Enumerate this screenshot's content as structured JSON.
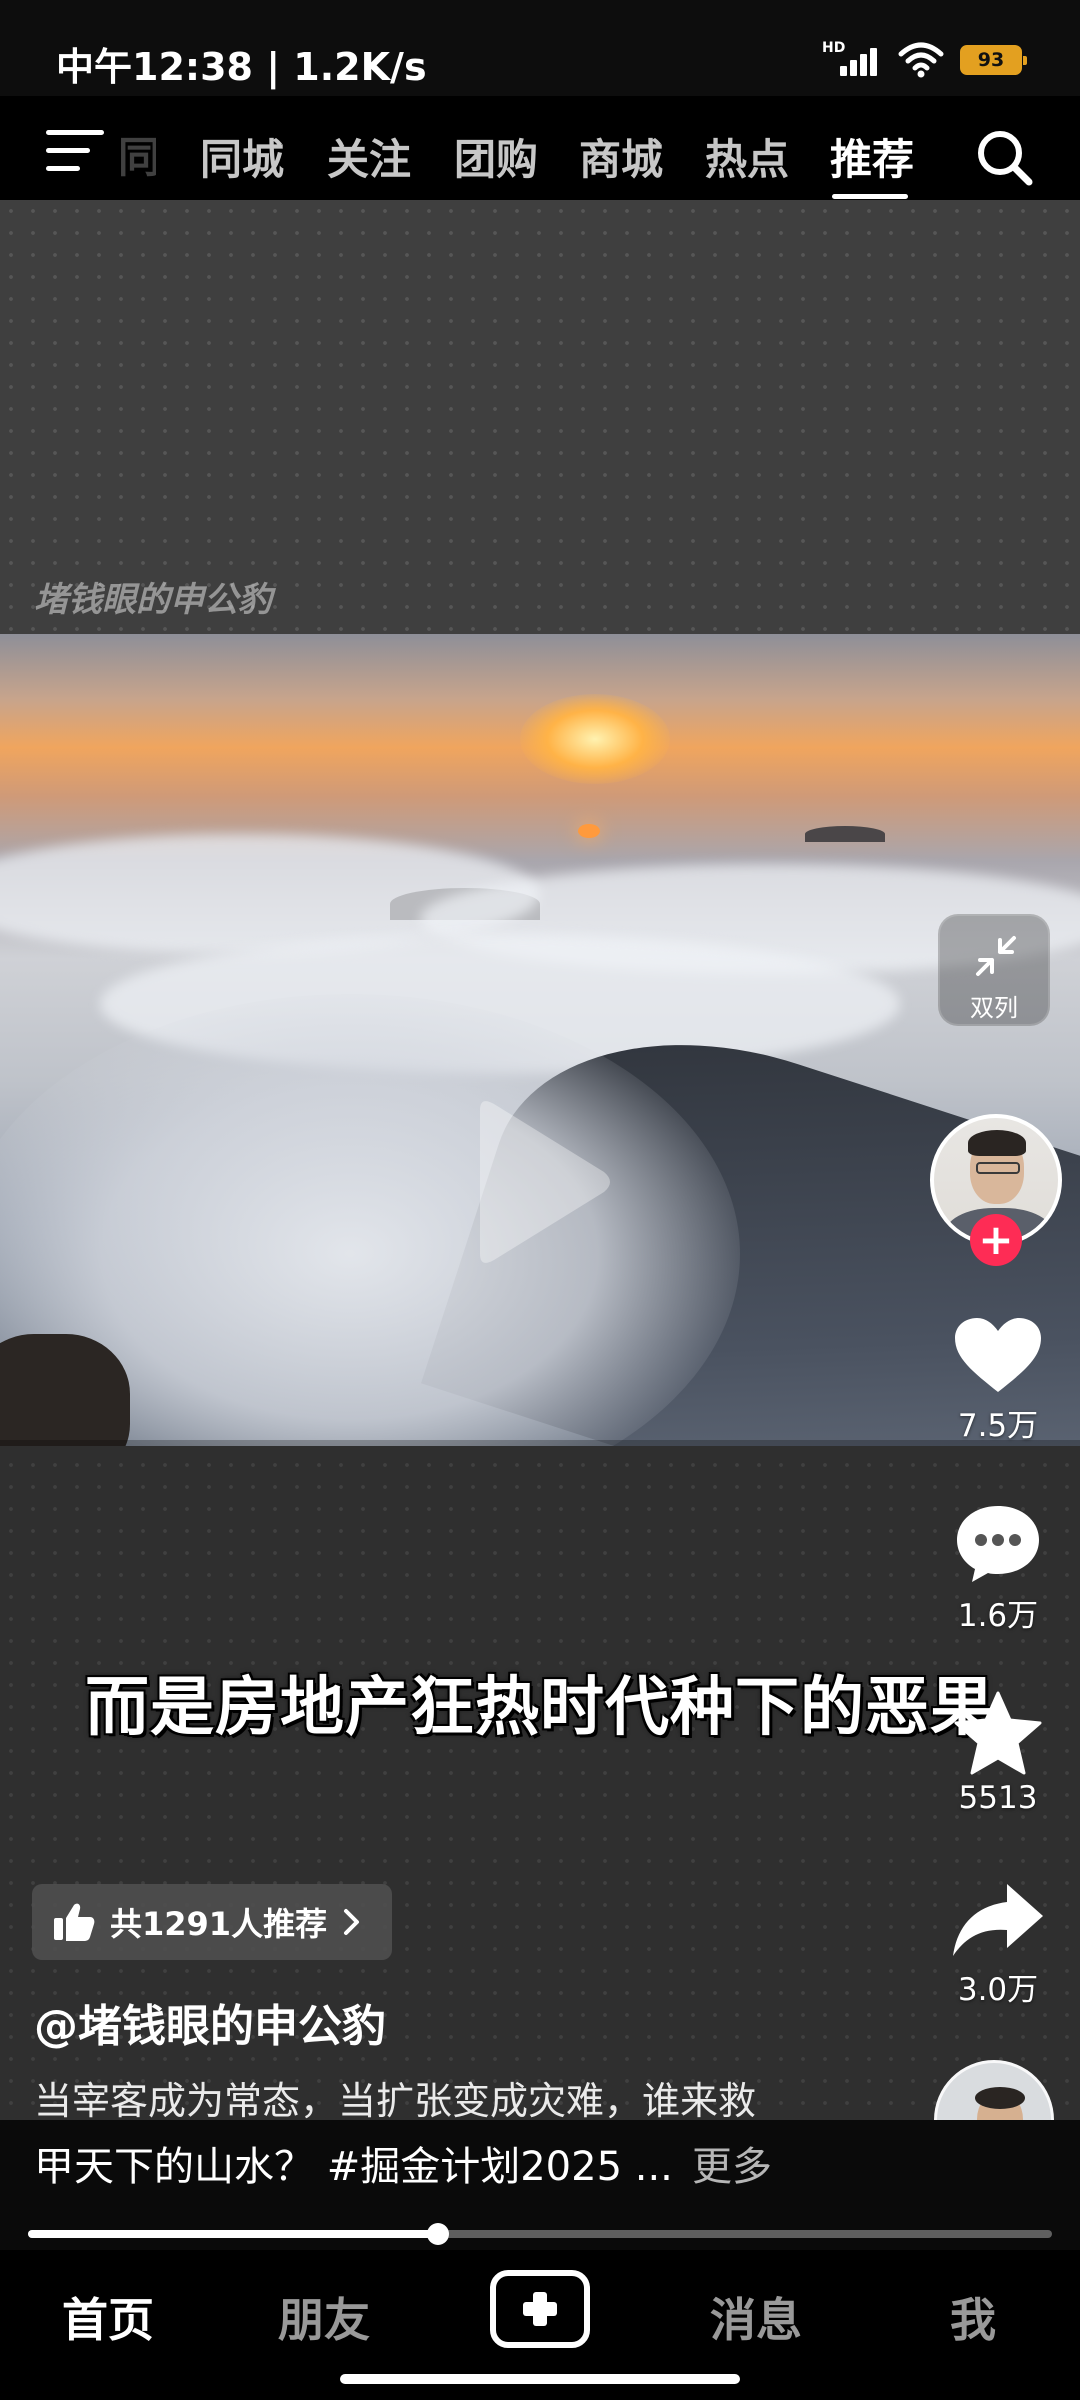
{
  "status_bar": {
    "time": "中午12:38 | 1.2K/s",
    "signal_label": "HD",
    "battery": "93",
    "battery_color": "#e3a020"
  },
  "top_nav": {
    "partial_tab": "同",
    "tabs": [
      {
        "label": "同城",
        "active": false
      },
      {
        "label": "关注",
        "active": false
      },
      {
        "label": "团购",
        "active": false
      },
      {
        "label": "商城",
        "active": false
      },
      {
        "label": "热点",
        "active": false
      },
      {
        "label": "推荐",
        "active": true
      }
    ],
    "icons": {
      "menu": "menu-icon",
      "search": "search-icon"
    }
  },
  "video": {
    "watermark": "堵钱眼的申公豹",
    "caption": "而是房地产狂热时代种下的恶果",
    "progress": 0.4
  },
  "right_rail": {
    "dual_col_label": "双列",
    "follow_symbol": "+",
    "like_count": "7.5万",
    "comment_count": "1.6万",
    "favorite_count": "5513",
    "share_count": "3.0万",
    "accent_color": "#fe2c55"
  },
  "info": {
    "recommend": "共1291人推荐",
    "username": "@堵钱眼的申公豹",
    "desc_line1": "当宰客成为常态，当扩张变成灾难，谁来救",
    "desc_line2": "甲天下的山水？ #掘金计划2025 ...",
    "more": "更多"
  },
  "bottom_nav": {
    "items": [
      {
        "label": "首页",
        "active": true
      },
      {
        "label": "朋友",
        "active": false
      },
      {
        "label": "消息",
        "active": false
      },
      {
        "label": "我",
        "active": false
      }
    ]
  }
}
